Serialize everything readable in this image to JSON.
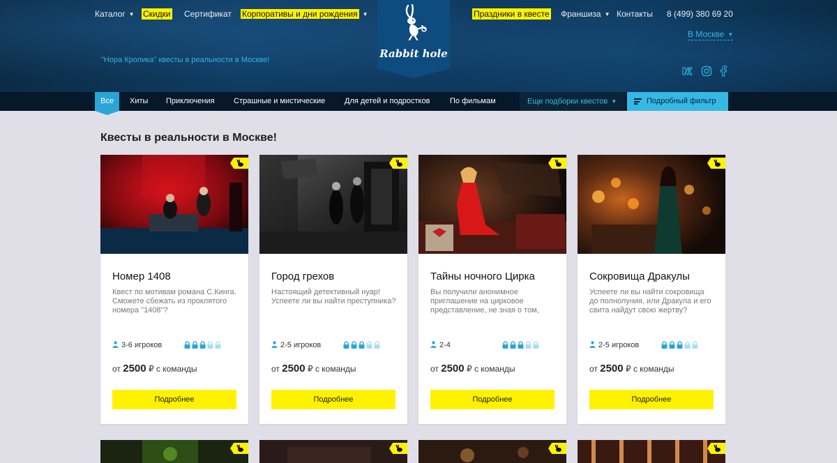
{
  "nav": {
    "left": [
      {
        "label": "Каталог",
        "dropdown": true
      },
      {
        "label": "Скидки",
        "highlight": true
      },
      {
        "label": "Сертификат"
      },
      {
        "label": "Корпоративы и дни рождения",
        "highlight": true,
        "dropdown": true
      }
    ],
    "right": [
      {
        "label": "Праздники в квесте",
        "highlight": true
      },
      {
        "label": "Франшиза",
        "dropdown": true
      },
      {
        "label": "Контакты"
      }
    ],
    "phone": "8 (499) 380 69 20",
    "city": "В Москве",
    "socials": [
      "vk-icon",
      "instagram-icon",
      "facebook-icon"
    ]
  },
  "logo": {
    "text": "Rabbit hole",
    "icon": "rabbit-icon"
  },
  "tagline": "\"Нора Кролика\" квесты в реальности в Москве!",
  "categories": {
    "items": [
      "Все",
      "Хиты",
      "Приключения",
      "Страшные и мистические",
      "Для детей и подростков",
      "По фильмам"
    ],
    "active": "Все",
    "more": "Еще подборки квестов",
    "filter": "Подробный фильтр"
  },
  "main": {
    "title": "Квесты в реальности в Москве!"
  },
  "quests": [
    {
      "title": "Номер 1408",
      "description": "Квест по мотивам романа С.Кинга. Сможете сбежать из проклятого номера \"1408\"?",
      "players": "3-6 игроков",
      "difficulty": 3,
      "difficulty_max": 5,
      "price_prefix": "от",
      "price": "2500",
      "price_suffix": "₽ с команды",
      "button": "Подробнее"
    },
    {
      "title": "Город грехов",
      "description": "Настоящий детективный нуар! Успеете ли вы найти преступника?",
      "players": "2-5 игроков",
      "difficulty": 3,
      "difficulty_max": 5,
      "price_prefix": "от",
      "price": "2500",
      "price_suffix": "₽ с команды",
      "button": "Подробнее"
    },
    {
      "title": "Тайны ночного Цирка",
      "description": "Вы получили анонимное приглашение на цирковое представление, не зная о том,",
      "players": "2-4",
      "difficulty": 3,
      "difficulty_max": 5,
      "price_prefix": "от",
      "price": "2500",
      "price_suffix": "₽ с команды",
      "button": "Подробнее"
    },
    {
      "title": "Сокровища Дракулы",
      "description": "Успеете ли вы найти сокровища до полнолуния, или Дракула и его свита найдут свою жертву?",
      "players": "2-5 игроков",
      "difficulty": 3,
      "difficulty_max": 5,
      "price_prefix": "от",
      "price": "2500",
      "price_suffix": "₽ с команды",
      "button": "Подробнее"
    }
  ],
  "colors": {
    "accent_yellow": "#fff200",
    "accent_blue": "#2aa6d6",
    "header_bg": "#0d3558",
    "lock_active": "#2aa6d6",
    "lock_inactive": "#a9def2"
  }
}
